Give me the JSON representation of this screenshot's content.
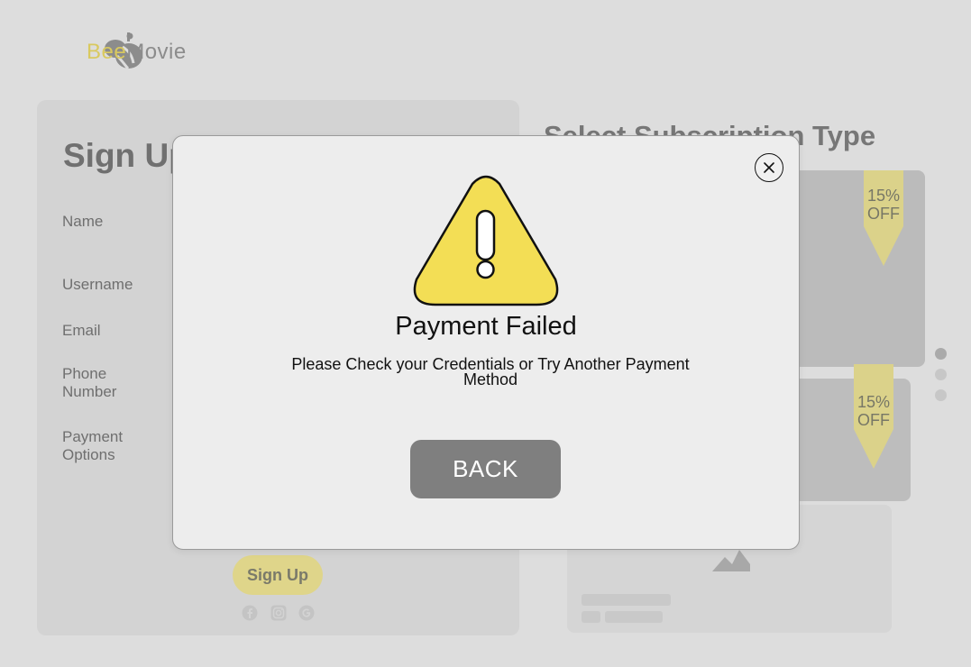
{
  "brand": {
    "name_part1": "BeeMovie",
    "logo_icon": "bee-logo-icon"
  },
  "signup_form": {
    "title": "Sign Up",
    "fields": [
      {
        "label": "Name"
      },
      {
        "label": "Username"
      },
      {
        "label": "Email"
      },
      {
        "label": "Phone Number"
      },
      {
        "label": "Payment Options"
      }
    ],
    "submit_label": "Sign Up",
    "social_icons": [
      "facebook-icon",
      "instagram-icon",
      "google-icon"
    ]
  },
  "subscription": {
    "title": "Select Subscription Type",
    "plans": [
      {
        "discount": "15% OFF"
      },
      {
        "discount": "15% OFF"
      }
    ],
    "carousel_pages": 3,
    "carousel_active_page": 1
  },
  "modal": {
    "icon": "warning-icon",
    "title": "Payment Failed",
    "message": "Please Check your Credentials or Try Another Payment Method",
    "back_label": "BACK",
    "close_icon": "close-icon"
  },
  "colors": {
    "accent_yellow": "#f3de55",
    "overlay_gray": "#dddddd",
    "button_gray": "#7f7f7f"
  }
}
